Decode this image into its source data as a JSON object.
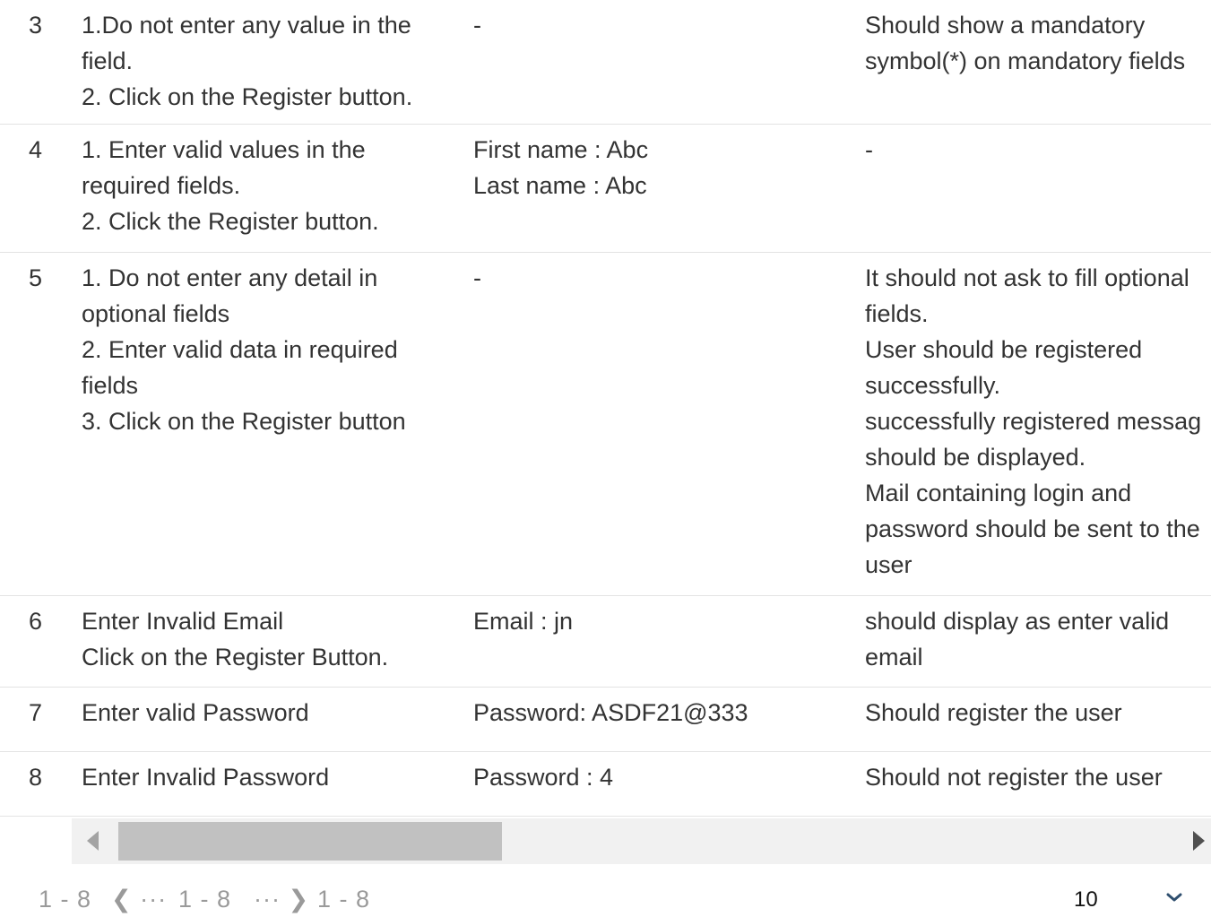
{
  "rows": [
    {
      "num": "3",
      "steps": [
        "1.Do not enter any value in the",
        "field.",
        "2. Click on the Register button."
      ],
      "data": [
        "-"
      ],
      "expected": [
        "Should show a mandatory",
        "symbol(*) on mandatory fields"
      ]
    },
    {
      "num": "4",
      "steps": [
        "1. Enter valid values in the",
        "required fields.",
        "2. Click the Register button."
      ],
      "data": [
        "First name : Abc",
        "Last name : Abc"
      ],
      "expected": [
        "-"
      ]
    },
    {
      "num": "5",
      "steps": [
        "1. Do not enter any detail in",
        "optional fields",
        "2. Enter valid data in required",
        "fields",
        "3. Click on the Register button"
      ],
      "data": [
        "-"
      ],
      "expected": [
        "It should not ask to fill optional",
        "fields.",
        "User should be registered",
        "successfully.",
        "successfully registered messag",
        "should be displayed.",
        "Mail containing login and",
        "password should be sent to the",
        "user"
      ]
    },
    {
      "num": "6",
      "steps": [
        "Enter Invalid Email",
        "Click on the Register Button."
      ],
      "data": [
        "Email : jn"
      ],
      "expected": [
        "should display as enter valid",
        "email"
      ]
    },
    {
      "num": "7",
      "steps": [
        "Enter valid Password"
      ],
      "data": [
        "Password: ASDF21@333"
      ],
      "expected": [
        "Should register the user"
      ]
    },
    {
      "num": "8",
      "steps": [
        "Enter Invalid Password"
      ],
      "data": [
        "Password : 4"
      ],
      "expected": [
        "Should not register the user"
      ]
    }
  ],
  "pagination": {
    "range_first": "1 - 8",
    "prev_label": "❮ ···",
    "range_middle": "1 - 8",
    "next_label": "··· ❯",
    "range_last": "1 - 8",
    "page_size": "10",
    "page_size_icon": "chevron-down-icon"
  },
  "colors": {
    "text": "#333333",
    "divider": "#e3e3e3",
    "scroll_track": "#f1f1f1",
    "scroll_thumb": "#c1c1c1",
    "pager_text": "#9a9a9a"
  }
}
